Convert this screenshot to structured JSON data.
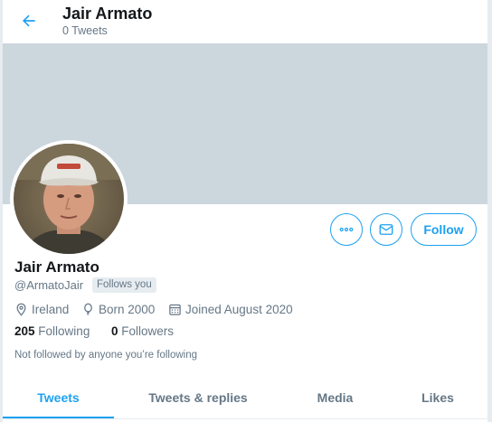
{
  "header": {
    "title": "Jair Armato",
    "subtitle": "0 Tweets",
    "back_icon": "arrow-left-icon"
  },
  "colors": {
    "accent": "#1da1f2",
    "banner": "#ccd6dd",
    "muted_text": "#657786",
    "primary_text": "#14171a"
  },
  "profile": {
    "name": "Jair Armato",
    "handle": "@ArmatoJair",
    "follows_you_badge": "Follows you",
    "location": "Ireland",
    "born": "Born 2000",
    "joined": "Joined August 2020",
    "following_count": "205",
    "following_label": "Following",
    "followers_count": "0",
    "followers_label": "Followers",
    "not_followed_text": "Not followed by anyone you’re following"
  },
  "actions": {
    "more_icon": "more-horizontal-icon",
    "message_icon": "envelope-icon",
    "follow_label": "Follow"
  },
  "tabs": [
    {
      "label": "Tweets",
      "active": true
    },
    {
      "label": "Tweets & replies",
      "active": false
    },
    {
      "label": "Media",
      "active": false
    },
    {
      "label": "Likes",
      "active": false
    }
  ]
}
